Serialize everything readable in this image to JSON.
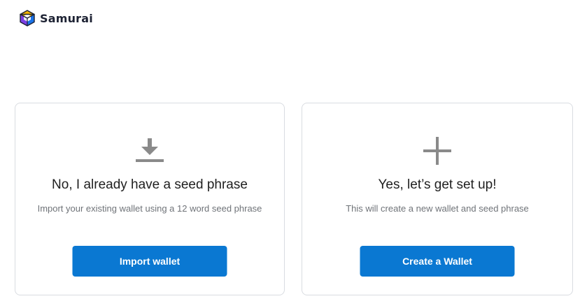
{
  "app": {
    "name": "Samurai",
    "logo_icon": "samurai-cube-logo"
  },
  "options": {
    "import": {
      "icon": "download-icon",
      "title": "No, I already have a seed phrase",
      "subtitle": "Import your existing wallet using a 12 word seed phrase",
      "button_label": "Import wallet"
    },
    "create": {
      "icon": "plus-icon",
      "title": "Yes, let’s get set up!",
      "subtitle": "This will create a new wallet and seed phrase",
      "button_label": "Create a Wallet"
    }
  },
  "colors": {
    "primary_button": "#0a78d2",
    "icon_gray": "#8a8a8a",
    "card_border": "#d9dce1"
  }
}
